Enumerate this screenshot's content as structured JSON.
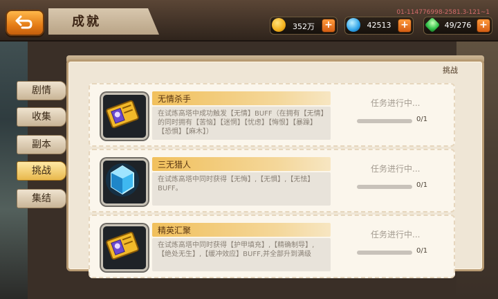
{
  "header": {
    "title": "成就",
    "build_id": "01-114776998-2581.3-121~1"
  },
  "resources": [
    {
      "name": "gold",
      "value": "352万",
      "icon": "gold-coin-icon",
      "color": "#f2b01c"
    },
    {
      "name": "crystal",
      "value": "42513",
      "icon": "blue-crystal-icon",
      "color": "#2fa3e8"
    },
    {
      "name": "energy",
      "value": "49/276",
      "icon": "green-gem-icon",
      "color": "#33c24a"
    }
  ],
  "panel": {
    "tab_header": "挑战"
  },
  "sidebar": {
    "tabs": [
      {
        "label": "剧情",
        "active": false
      },
      {
        "label": "收集",
        "active": false
      },
      {
        "label": "副本",
        "active": false
      },
      {
        "label": "挑战",
        "active": true
      },
      {
        "label": "集结",
        "active": false
      }
    ]
  },
  "achievements": [
    {
      "title": "无情杀手",
      "description": "在试炼高塔中成功触发【无情】BUFF（在拥有【无情】的同时拥有【苦恼】【迷惘】【忧虑】【悔恨】【暴躁】【恐惧】【麻木】）",
      "status": "任务进行中...",
      "progress": "0/1",
      "progress_fraction": 0,
      "icon": "ticket-icon"
    },
    {
      "title": "三无猎人",
      "description": "在试炼高塔中同时获得【无悔】,【无惧】,【无怯】BUFF。",
      "status": "任务进行中...",
      "progress": "0/1",
      "progress_fraction": 0,
      "icon": "blue-crystal-icon"
    },
    {
      "title": "精英汇聚",
      "description": "在试炼高塔中同时获得【护甲填充】,【精确制导】,【绝处无生】,【缓冲效应】BUFF,并全部升到满级",
      "status": "任务进行中...",
      "progress": "0/1",
      "progress_fraction": 0,
      "icon": "ticket-icon"
    }
  ]
}
